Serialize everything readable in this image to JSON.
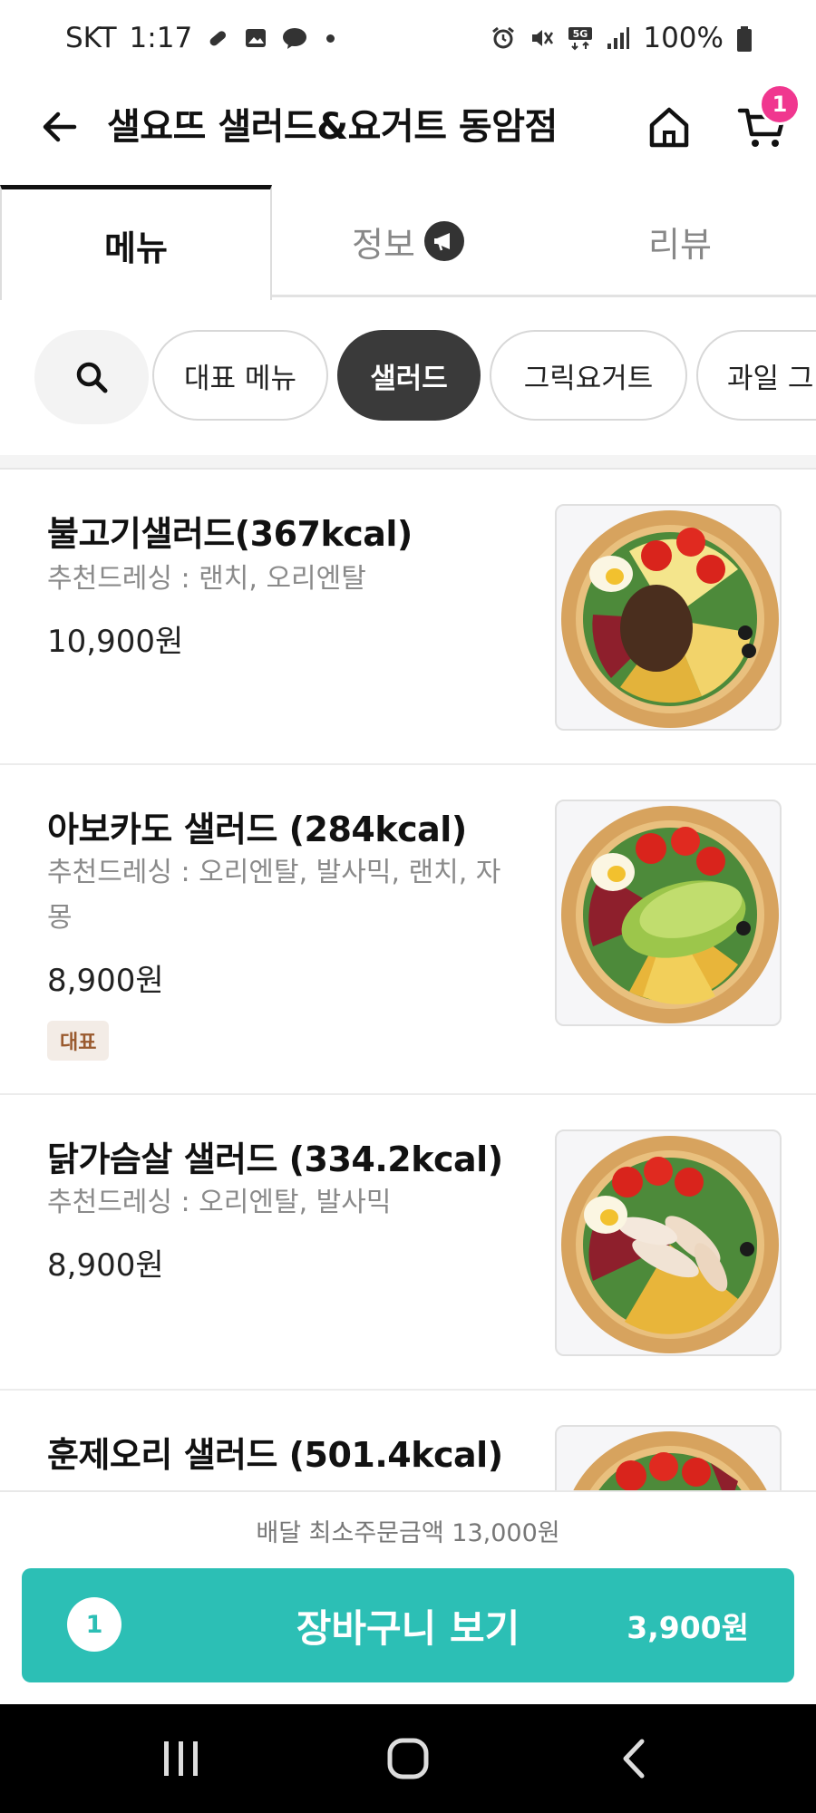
{
  "status_bar": {
    "carrier": "SKT",
    "time": "1:17",
    "battery": "100%",
    "network": "5G"
  },
  "header": {
    "title": "샐요뜨 샐러드&요거트 동암점",
    "cart_badge": "1"
  },
  "tabs": [
    {
      "label": "메뉴",
      "active": true
    },
    {
      "label": "정보",
      "active": false
    },
    {
      "label": "리뷰",
      "active": false
    }
  ],
  "categories": [
    {
      "label": "대표 메뉴",
      "active": false
    },
    {
      "label": "샐러드",
      "active": true
    },
    {
      "label": "그릭요거트",
      "active": false
    },
    {
      "label": "과일 그",
      "active": false
    }
  ],
  "menu_items": [
    {
      "name": "불고기샐러드(367kcal)",
      "desc": "추천드레싱 : 랜치, 오리엔탈",
      "price": "10,900원",
      "tag": ""
    },
    {
      "name": "아보카도 샐러드 (284kcal)",
      "desc": "추천드레싱 : 오리엔탈, 발사믹, 랜치, 자몽",
      "price": "8,900원",
      "tag": "대표"
    },
    {
      "name": "닭가슴살 샐러드 (334.2kcal)",
      "desc": "추천드레싱 : 오리엔탈, 발사믹",
      "price": "8,900원",
      "tag": ""
    },
    {
      "name": "훈제오리 샐러드 (501.4kcal)",
      "desc": "",
      "price": "",
      "tag": ""
    }
  ],
  "bottom": {
    "min_order": "배달 최소주문금액 13,000원",
    "cart_count": "1",
    "cart_label": "장바구니 보기",
    "cart_total": "3,900원"
  },
  "colors": {
    "accent": "#2cbfb5",
    "badge": "#f0378f",
    "active_chip": "#3a3a3a"
  }
}
